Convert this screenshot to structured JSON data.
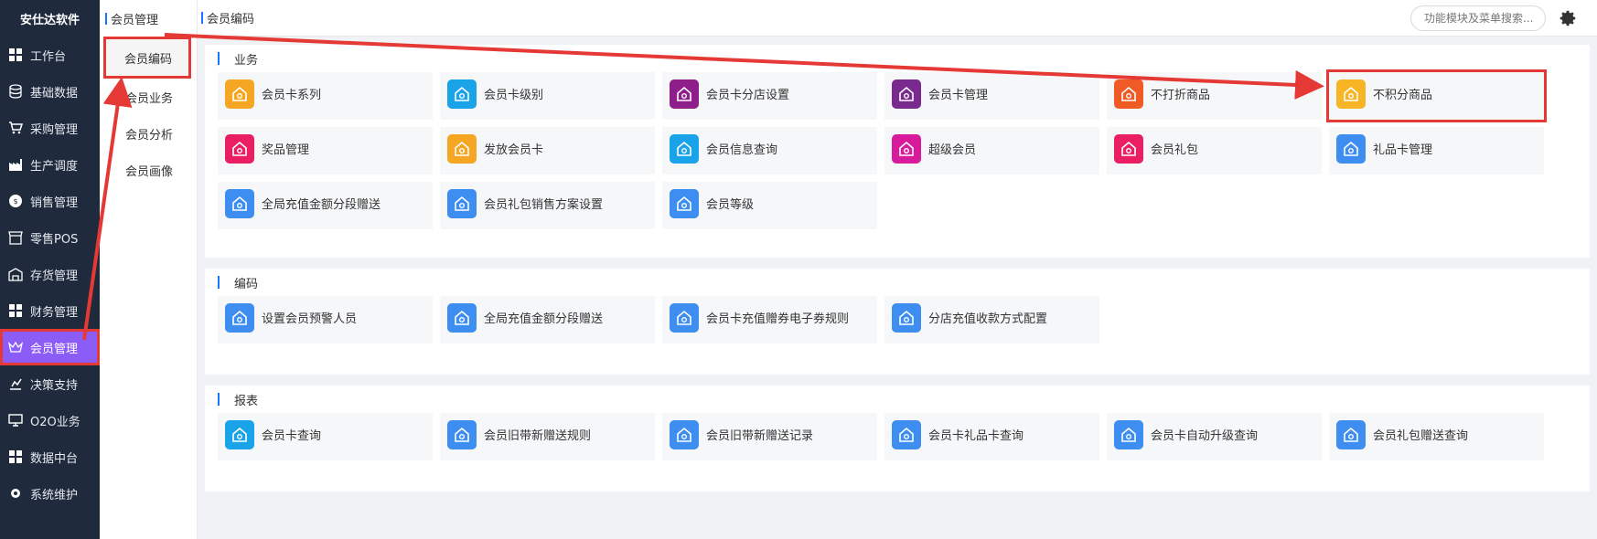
{
  "sidebar": {
    "brand": "安仕达软件",
    "items": [
      {
        "label": "工作台",
        "icon": "grid-icon"
      },
      {
        "label": "基础数据",
        "icon": "database-icon"
      },
      {
        "label": "采购管理",
        "icon": "cart-icon"
      },
      {
        "label": "生产调度",
        "icon": "factory-icon"
      },
      {
        "label": "销售管理",
        "icon": "sales-icon"
      },
      {
        "label": "零售POS",
        "icon": "store-icon"
      },
      {
        "label": "存货管理",
        "icon": "warehouse-icon"
      },
      {
        "label": "财务管理",
        "icon": "grid-icon"
      },
      {
        "label": "会员管理",
        "icon": "crown-icon",
        "active": true
      },
      {
        "label": "决策支持",
        "icon": "chart-icon"
      },
      {
        "label": "O2O业务",
        "icon": "monitor-icon"
      },
      {
        "label": "数据中台",
        "icon": "grid-icon"
      },
      {
        "label": "系统维护",
        "icon": "gear-icon"
      }
    ]
  },
  "subpanel": {
    "title": "会员管理",
    "items": [
      {
        "label": "会员编码",
        "active": true
      },
      {
        "label": "会员业务"
      },
      {
        "label": "会员分析"
      },
      {
        "label": "会员画像"
      }
    ]
  },
  "topbar": {
    "breadcrumb": "会员编码",
    "search_placeholder": "功能模块及菜单搜索..."
  },
  "sections": [
    {
      "title": "业务",
      "cards": [
        {
          "label": "会员卡系列",
          "color": "#f5a623"
        },
        {
          "label": "会员卡级别",
          "color": "#1aa3e8"
        },
        {
          "label": "会员卡分店设置",
          "color": "#8e1e8a"
        },
        {
          "label": "会员卡管理",
          "color": "#7a2a8e"
        },
        {
          "label": "不打折商品",
          "color": "#f05a24"
        },
        {
          "label": "不积分商品",
          "color": "#f7b526"
        },
        {
          "label": "奖品管理",
          "color": "#e91e63"
        },
        {
          "label": "发放会员卡",
          "color": "#f5a623"
        },
        {
          "label": "会员信息查询",
          "color": "#1aa3e8"
        },
        {
          "label": "超级会员",
          "color": "#d81b9c"
        },
        {
          "label": "会员礼包",
          "color": "#e91e63"
        },
        {
          "label": "礼品卡管理",
          "color": "#3d8ef0"
        },
        {
          "label": "全局充值金额分段赠送",
          "color": "#3d8ef0"
        },
        {
          "label": "会员礼包销售方案设置",
          "color": "#3d8ef0"
        },
        {
          "label": "会员等级",
          "color": "#3d8ef0"
        }
      ]
    },
    {
      "title": "编码",
      "cards": [
        {
          "label": "设置会员预警人员",
          "color": "#3d8ef0"
        },
        {
          "label": "全局充值金额分段赠送",
          "color": "#3d8ef0"
        },
        {
          "label": "会员卡充值赠券电子券规则",
          "color": "#3d8ef0"
        },
        {
          "label": "分店充值收款方式配置",
          "color": "#3d8ef0"
        }
      ]
    },
    {
      "title": "报表",
      "cards": [
        {
          "label": "会员卡查询",
          "color": "#1aa3e8"
        },
        {
          "label": "会员旧带新赠送规则",
          "color": "#3d8ef0"
        },
        {
          "label": "会员旧带新赠送记录",
          "color": "#3d8ef0"
        },
        {
          "label": "会员卡礼品卡查询",
          "color": "#3d8ef0"
        },
        {
          "label": "会员卡自动升级查询",
          "color": "#3d8ef0"
        },
        {
          "label": "会员礼包赠送查询",
          "color": "#3d8ef0"
        }
      ]
    }
  ],
  "colors": {
    "sidebar_bg": "#1f2a3d",
    "active_nav": "#8c5cf6",
    "highlight": "#e53935",
    "accent": "#1677ff"
  }
}
